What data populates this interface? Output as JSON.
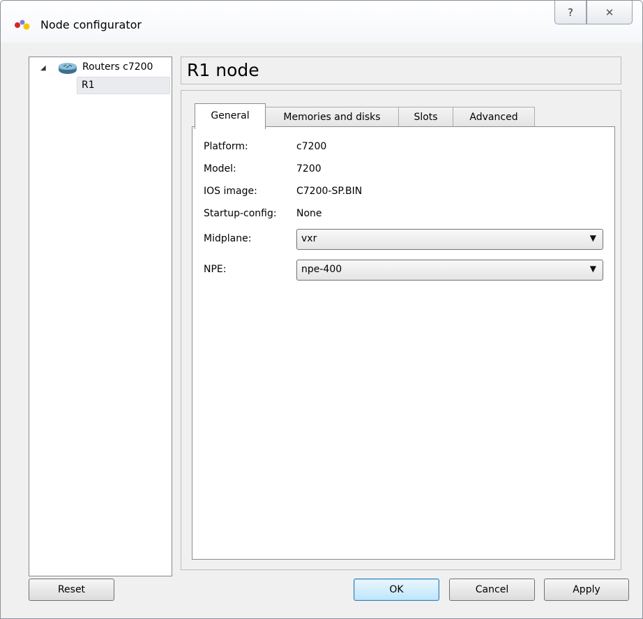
{
  "window": {
    "title": "Node configurator",
    "help_glyph": "?",
    "close_glyph": "✕"
  },
  "tree": {
    "expander_glyph": "◢",
    "parent_label": "Routers c7200",
    "parent_icon": "router-icon",
    "child_label": "R1"
  },
  "node_header": {
    "title": "R1 node"
  },
  "tabs": [
    {
      "label": "General"
    },
    {
      "label": "Memories and disks"
    },
    {
      "label": "Slots"
    },
    {
      "label": "Advanced"
    }
  ],
  "general": {
    "platform_label": "Platform:",
    "platform_value": "c7200",
    "model_label": "Model:",
    "model_value": "7200",
    "ios_label": "IOS image:",
    "ios_value": "C7200-SP.BIN",
    "startup_label": "Startup-config:",
    "startup_value": "None",
    "midplane_label": "Midplane:",
    "midplane_value": "vxr",
    "npe_label": "NPE:",
    "npe_value": "npe-400",
    "dropdown_glyph": "▼"
  },
  "buttons": {
    "reset": "Reset",
    "ok": "OK",
    "cancel": "Cancel",
    "apply": "Apply"
  },
  "colors": {
    "default_button_border": "#3c7fb1",
    "tree_selection": "#e9ebee"
  }
}
